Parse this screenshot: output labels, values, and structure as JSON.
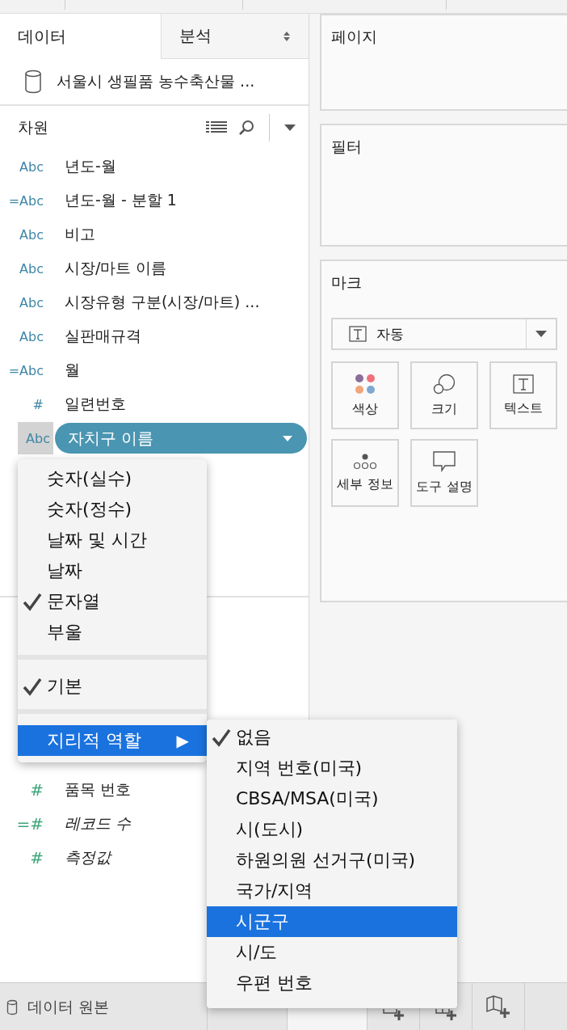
{
  "tabs": [
    {
      "label": "데이터",
      "selected": true
    },
    {
      "label": "분석",
      "selected": false
    }
  ],
  "data_source": {
    "name": "서울시 생필품 농수축산물 ..."
  },
  "dimensions": {
    "title": "차원",
    "fields": [
      {
        "type_label": "Abc",
        "name": "년도-월",
        "selected": false
      },
      {
        "type_label": "=Abc",
        "name": "년도-월 - 분할 1",
        "selected": false
      },
      {
        "type_label": "Abc",
        "name": "비고",
        "selected": false
      },
      {
        "type_label": "Abc",
        "name": "시장/마트 이름",
        "selected": false
      },
      {
        "type_label": "Abc",
        "name": "시장유형 구분(시장/마트) ...",
        "selected": false
      },
      {
        "type_label": "Abc",
        "name": "실판매규격",
        "selected": false
      },
      {
        "type_label": "=Abc",
        "name": "월",
        "selected": false
      },
      {
        "type_label": "#",
        "name": "일련번호",
        "selected": false
      },
      {
        "type_label": "Abc",
        "name": "자치구 이름",
        "selected": true
      }
    ]
  },
  "measures": {
    "fields": [
      {
        "type_label": "#",
        "name": "품목 번호",
        "generated": false
      },
      {
        "type_label": "=#",
        "name": "레코드 수",
        "generated": true
      },
      {
        "type_label": "#",
        "name": "측정값",
        "generated": true
      }
    ]
  },
  "context_menu": {
    "groups": [
      [
        {
          "label": "숫자(실수)",
          "checked": false,
          "selected": false
        },
        {
          "label": "숫자(정수)",
          "checked": false,
          "selected": false
        },
        {
          "label": "날짜 및 시간",
          "checked": false,
          "selected": false
        },
        {
          "label": "날짜",
          "checked": false,
          "selected": false
        },
        {
          "label": "문자열",
          "checked": true,
          "selected": false
        },
        {
          "label": "부울",
          "checked": false,
          "selected": false
        }
      ],
      [
        {
          "label": "기본",
          "checked": true,
          "selected": false
        }
      ],
      [
        {
          "label": "지리적 역할",
          "checked": false,
          "selected": true,
          "arrow": "▶"
        }
      ]
    ]
  },
  "submenu": {
    "items": [
      {
        "label": "없음",
        "checked": true,
        "selected": false
      },
      {
        "label": "지역 번호(미국)",
        "checked": false,
        "selected": false
      },
      {
        "label": "CBSA/MSA(미국)",
        "checked": false,
        "selected": false
      },
      {
        "label": "시(도시)",
        "checked": false,
        "selected": false
      },
      {
        "label": "하원의원 선거구(미국)",
        "checked": false,
        "selected": false
      },
      {
        "label": "국가/지역",
        "checked": false,
        "selected": false
      },
      {
        "label": "시군구",
        "checked": false,
        "selected": true
      },
      {
        "label": "시/도",
        "checked": false,
        "selected": false
      },
      {
        "label": "우편 번호",
        "checked": false,
        "selected": false
      }
    ]
  },
  "shelves": {
    "pages": "페이지",
    "filters": "필터"
  },
  "marks": {
    "title": "마크",
    "mark_type": "자동",
    "cards": [
      {
        "label": "색상",
        "kind": "color"
      },
      {
        "label": "크기",
        "kind": "size"
      },
      {
        "label": "텍스트",
        "kind": "text"
      },
      {
        "label": "세부 정보",
        "kind": "detail"
      },
      {
        "label": "도구 설명",
        "kind": "tooltip"
      }
    ]
  },
  "bottom_bar": {
    "data_source_tab": "데이터 원본"
  }
}
